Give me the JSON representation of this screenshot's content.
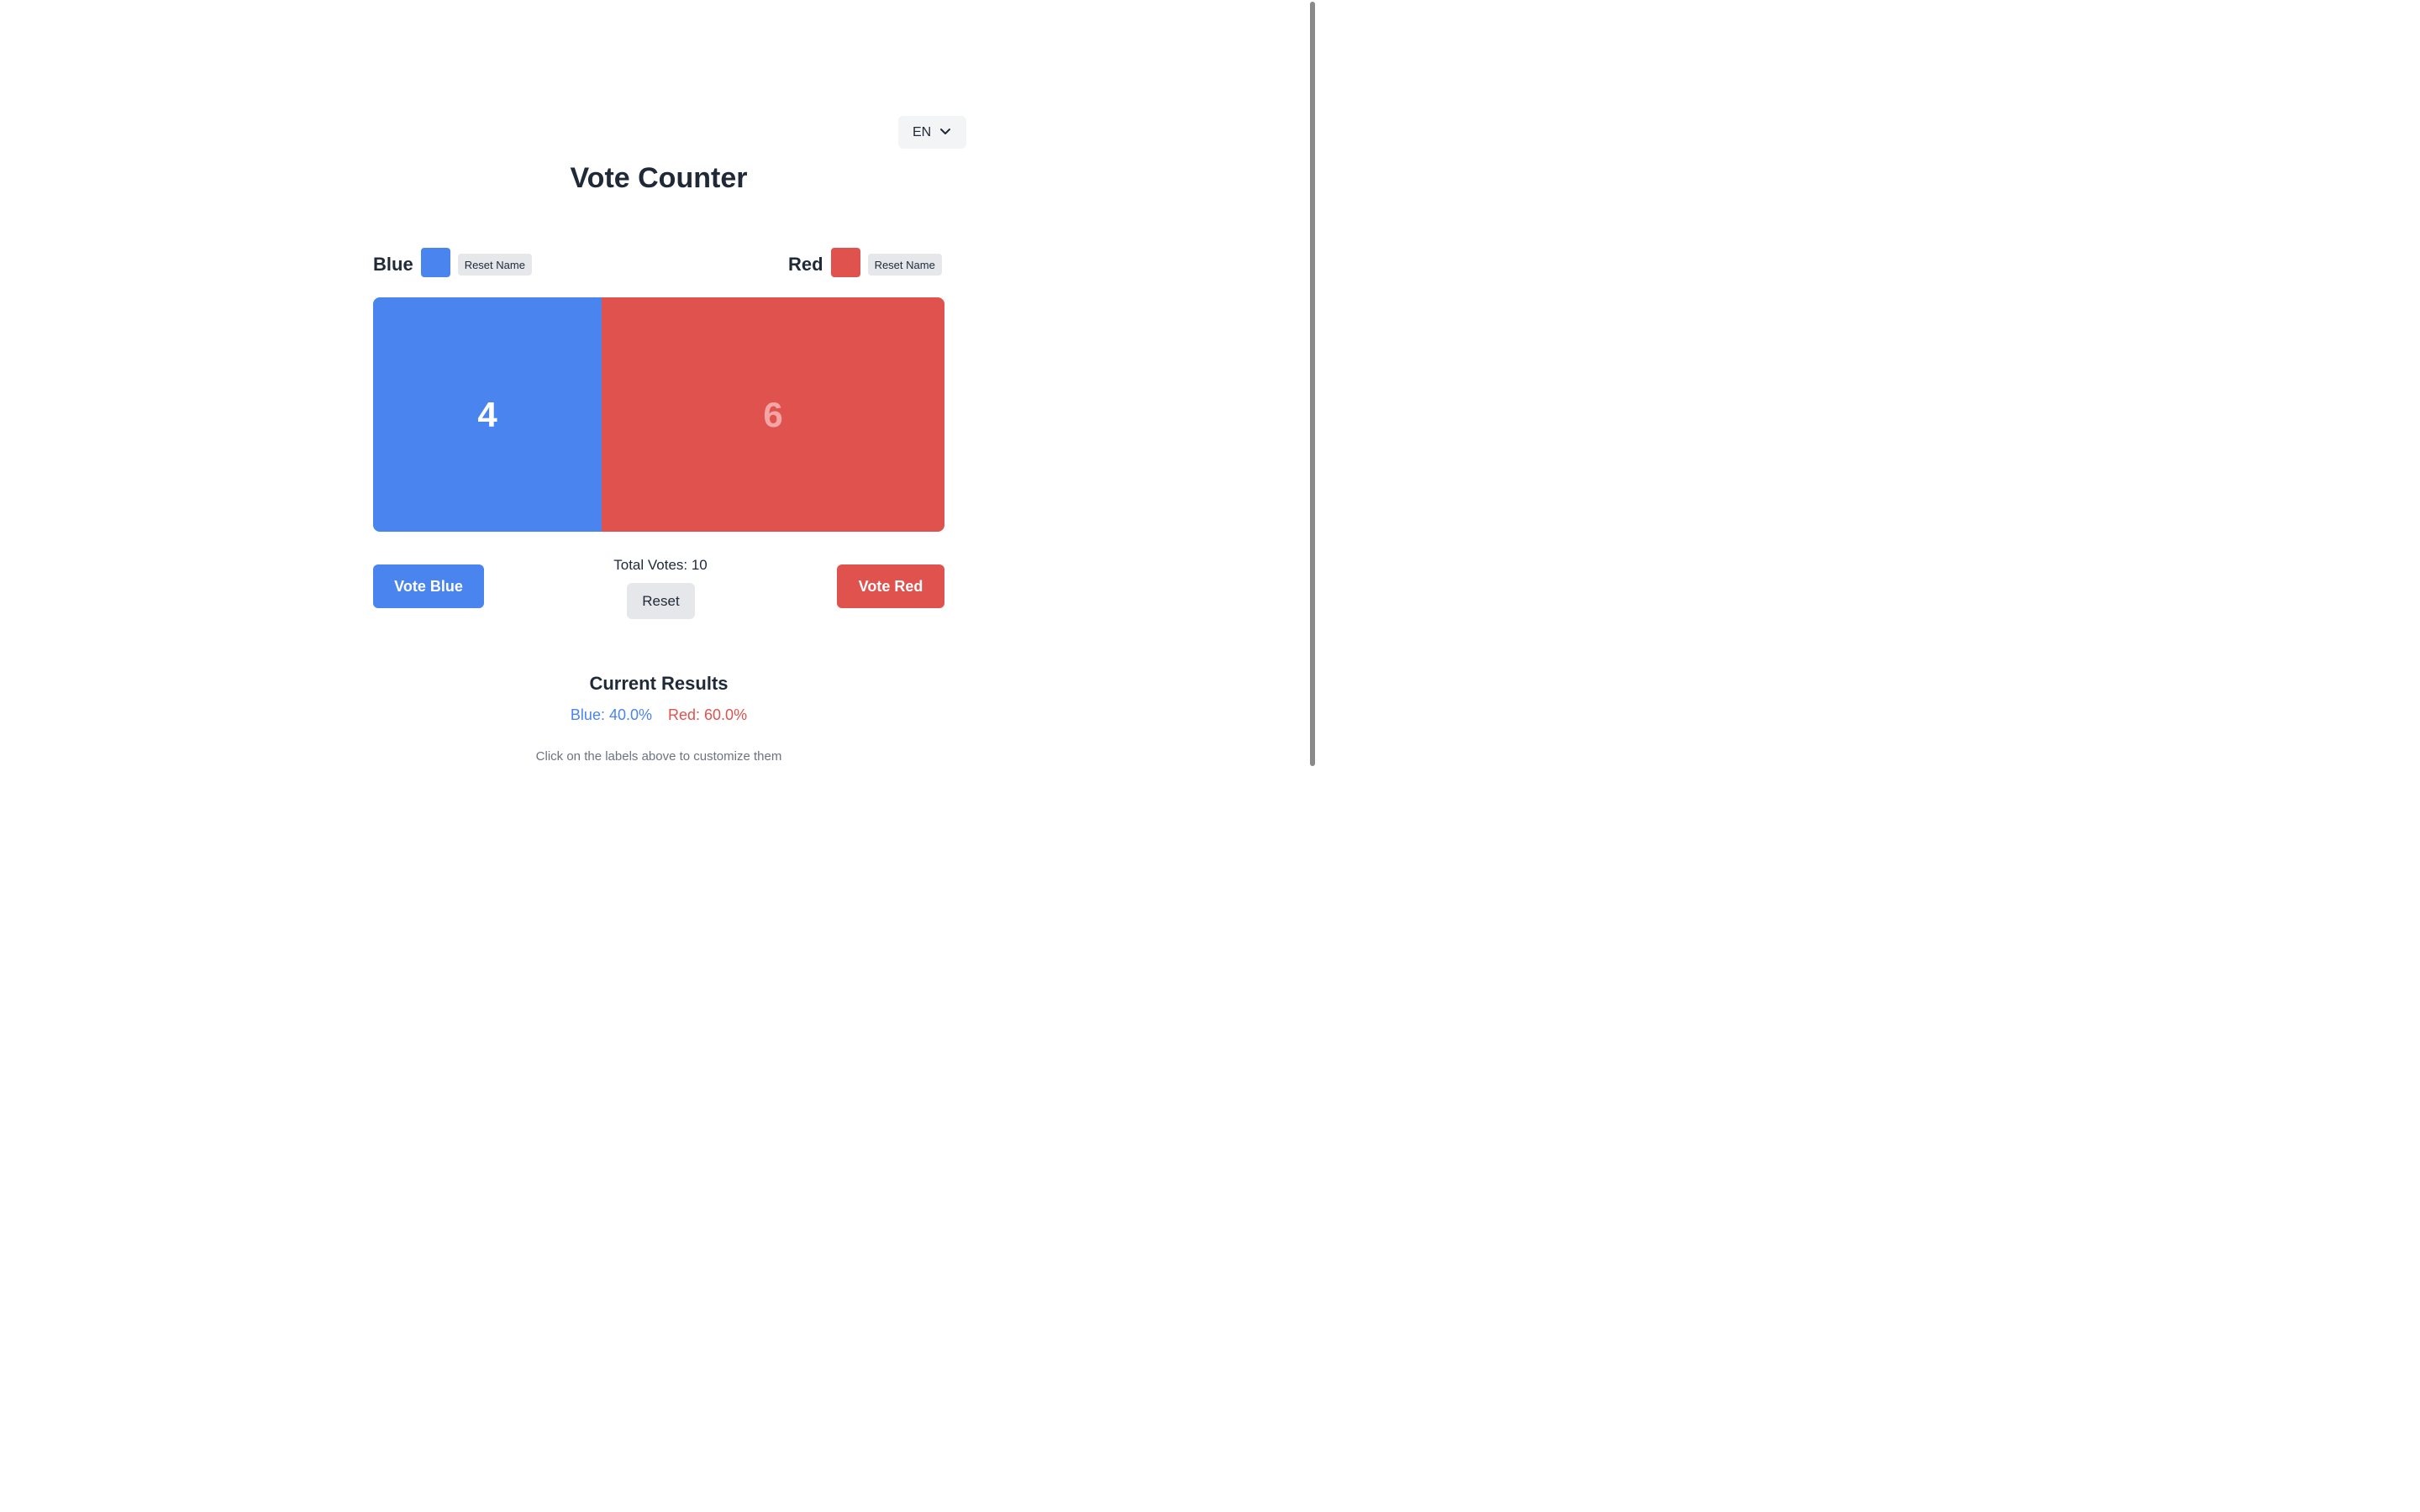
{
  "language": {
    "selected": "EN"
  },
  "title": "Vote Counter",
  "candidates": {
    "blue": {
      "name": "Blue",
      "color": "#4a84ee",
      "reset_label": "Reset Name",
      "votes": "4",
      "vote_label": "Vote Blue",
      "percent_text": "Blue: 40.0%"
    },
    "red": {
      "name": "Red",
      "color": "#df524e",
      "reset_label": "Reset Name",
      "votes": "6",
      "vote_label": "Vote Red",
      "percent_text": "Red: 60.0%"
    }
  },
  "total_votes_text": "Total Votes: 10",
  "reset_label": "Reset",
  "results": {
    "title": "Current Results"
  },
  "hint": "Click on the labels above to customize them",
  "icons": {
    "language_dropdown": "chevron-down-icon"
  }
}
